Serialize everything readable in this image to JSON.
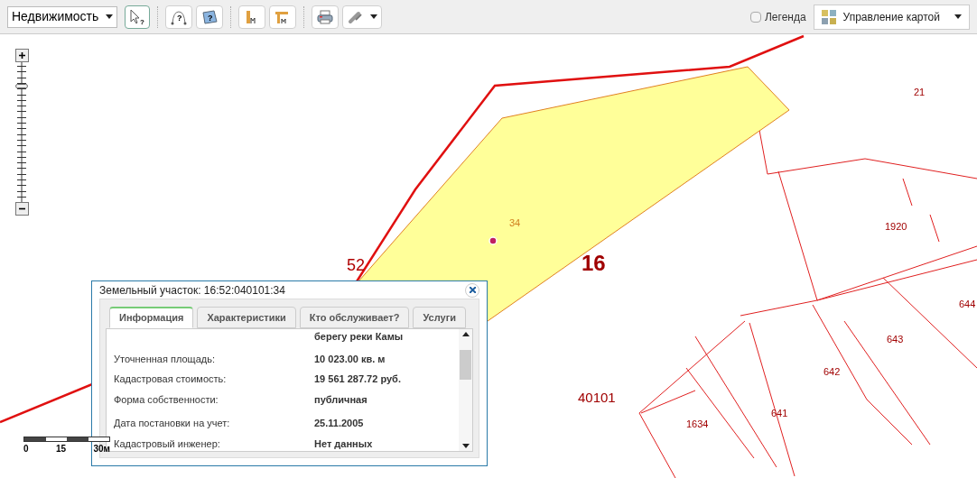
{
  "toolbar": {
    "layer_select": "Недвижимость",
    "tool_marks": [
      "?",
      "?",
      "?"
    ],
    "legend": {
      "label": "Легенда",
      "checked": false
    },
    "map_control": "Управление картой"
  },
  "zoom": {
    "level": 0.84
  },
  "map_labels": [
    {
      "text": "52",
      "kind": "district"
    },
    {
      "text": "16",
      "kind": "region"
    },
    {
      "text": "34",
      "kind": "selected"
    },
    {
      "text": "21",
      "kind": "parcel"
    },
    {
      "text": "1920",
      "kind": "parcel"
    },
    {
      "text": "644",
      "kind": "parcel"
    },
    {
      "text": "643",
      "kind": "parcel"
    },
    {
      "text": "642",
      "kind": "parcel"
    },
    {
      "text": "641",
      "kind": "parcel"
    },
    {
      "text": "1634",
      "kind": "parcel"
    },
    {
      "text": "40101",
      "kind": "quarter"
    }
  ],
  "scale_bar": [
    "0",
    "15",
    "30м"
  ],
  "popup": {
    "title": "Земельный участок: 16:52:040101:34",
    "tabs": [
      {
        "label": "Информация",
        "selected": true
      },
      {
        "label": "Характеристики",
        "selected": false
      },
      {
        "label": "Кто обслуживает?",
        "selected": false
      },
      {
        "label": "Услуги",
        "selected": false
      }
    ],
    "continued_value": "берегу реки Камы",
    "rows": [
      {
        "label": "Уточненная площадь:",
        "value": "10 023.00 кв. м"
      },
      {
        "label": "Кадастровая стоимость:",
        "value": "19 561 287.72 руб."
      },
      {
        "label": "Форма собственности:",
        "value": "публичная"
      },
      {
        "label": "Дата постановки на учет:",
        "value": "25.11.2005"
      },
      {
        "label": "Кадастровый инженер:",
        "value": "Нет данных"
      }
    ]
  }
}
